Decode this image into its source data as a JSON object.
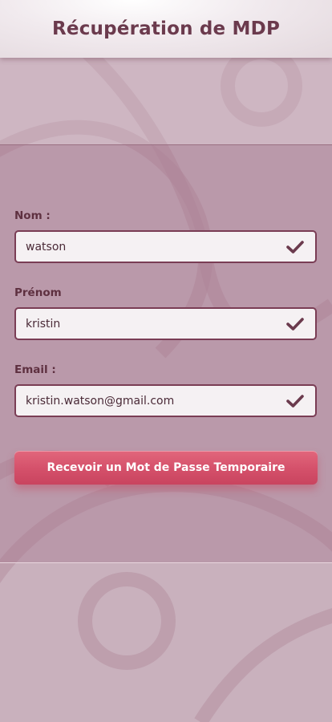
{
  "header": {
    "title": "Récupération de MDP"
  },
  "form": {
    "fields": [
      {
        "label": "Nom :",
        "value": "watson",
        "icon": "check-icon"
      },
      {
        "label": "Prénom",
        "value": "kristin",
        "icon": "check-icon"
      },
      {
        "label": "Email :",
        "value": "kristin.watson@gmail.com",
        "icon": "check-icon"
      }
    ],
    "submit_label": "Recevoir un Mot de Passe Temporaire"
  },
  "colors": {
    "background": "#c9b1bd",
    "title": "#6b3a4d",
    "field_border": "#7a3d55",
    "button": "#d4506a"
  }
}
